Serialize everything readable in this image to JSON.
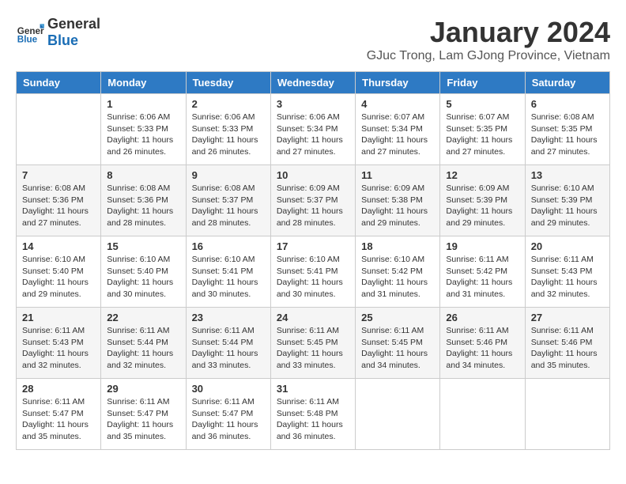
{
  "header": {
    "logo_general": "General",
    "logo_blue": "Blue",
    "month_title": "January 2024",
    "subtitle": "GJuc Trong, Lam GJong Province, Vietnam"
  },
  "columns": [
    "Sunday",
    "Monday",
    "Tuesday",
    "Wednesday",
    "Thursday",
    "Friday",
    "Saturday"
  ],
  "weeks": [
    [
      {
        "day": "",
        "info": ""
      },
      {
        "day": "1",
        "info": "Sunrise: 6:06 AM\nSunset: 5:33 PM\nDaylight: 11 hours\nand 26 minutes."
      },
      {
        "day": "2",
        "info": "Sunrise: 6:06 AM\nSunset: 5:33 PM\nDaylight: 11 hours\nand 26 minutes."
      },
      {
        "day": "3",
        "info": "Sunrise: 6:06 AM\nSunset: 5:34 PM\nDaylight: 11 hours\nand 27 minutes."
      },
      {
        "day": "4",
        "info": "Sunrise: 6:07 AM\nSunset: 5:34 PM\nDaylight: 11 hours\nand 27 minutes."
      },
      {
        "day": "5",
        "info": "Sunrise: 6:07 AM\nSunset: 5:35 PM\nDaylight: 11 hours\nand 27 minutes."
      },
      {
        "day": "6",
        "info": "Sunrise: 6:08 AM\nSunset: 5:35 PM\nDaylight: 11 hours\nand 27 minutes."
      }
    ],
    [
      {
        "day": "7",
        "info": "Sunrise: 6:08 AM\nSunset: 5:36 PM\nDaylight: 11 hours\nand 27 minutes."
      },
      {
        "day": "8",
        "info": "Sunrise: 6:08 AM\nSunset: 5:36 PM\nDaylight: 11 hours\nand 28 minutes."
      },
      {
        "day": "9",
        "info": "Sunrise: 6:08 AM\nSunset: 5:37 PM\nDaylight: 11 hours\nand 28 minutes."
      },
      {
        "day": "10",
        "info": "Sunrise: 6:09 AM\nSunset: 5:37 PM\nDaylight: 11 hours\nand 28 minutes."
      },
      {
        "day": "11",
        "info": "Sunrise: 6:09 AM\nSunset: 5:38 PM\nDaylight: 11 hours\nand 29 minutes."
      },
      {
        "day": "12",
        "info": "Sunrise: 6:09 AM\nSunset: 5:39 PM\nDaylight: 11 hours\nand 29 minutes."
      },
      {
        "day": "13",
        "info": "Sunrise: 6:10 AM\nSunset: 5:39 PM\nDaylight: 11 hours\nand 29 minutes."
      }
    ],
    [
      {
        "day": "14",
        "info": "Sunrise: 6:10 AM\nSunset: 5:40 PM\nDaylight: 11 hours\nand 29 minutes."
      },
      {
        "day": "15",
        "info": "Sunrise: 6:10 AM\nSunset: 5:40 PM\nDaylight: 11 hours\nand 30 minutes."
      },
      {
        "day": "16",
        "info": "Sunrise: 6:10 AM\nSunset: 5:41 PM\nDaylight: 11 hours\nand 30 minutes."
      },
      {
        "day": "17",
        "info": "Sunrise: 6:10 AM\nSunset: 5:41 PM\nDaylight: 11 hours\nand 30 minutes."
      },
      {
        "day": "18",
        "info": "Sunrise: 6:10 AM\nSunset: 5:42 PM\nDaylight: 11 hours\nand 31 minutes."
      },
      {
        "day": "19",
        "info": "Sunrise: 6:11 AM\nSunset: 5:42 PM\nDaylight: 11 hours\nand 31 minutes."
      },
      {
        "day": "20",
        "info": "Sunrise: 6:11 AM\nSunset: 5:43 PM\nDaylight: 11 hours\nand 32 minutes."
      }
    ],
    [
      {
        "day": "21",
        "info": "Sunrise: 6:11 AM\nSunset: 5:43 PM\nDaylight: 11 hours\nand 32 minutes."
      },
      {
        "day": "22",
        "info": "Sunrise: 6:11 AM\nSunset: 5:44 PM\nDaylight: 11 hours\nand 32 minutes."
      },
      {
        "day": "23",
        "info": "Sunrise: 6:11 AM\nSunset: 5:44 PM\nDaylight: 11 hours\nand 33 minutes."
      },
      {
        "day": "24",
        "info": "Sunrise: 6:11 AM\nSunset: 5:45 PM\nDaylight: 11 hours\nand 33 minutes."
      },
      {
        "day": "25",
        "info": "Sunrise: 6:11 AM\nSunset: 5:45 PM\nDaylight: 11 hours\nand 34 minutes."
      },
      {
        "day": "26",
        "info": "Sunrise: 6:11 AM\nSunset: 5:46 PM\nDaylight: 11 hours\nand 34 minutes."
      },
      {
        "day": "27",
        "info": "Sunrise: 6:11 AM\nSunset: 5:46 PM\nDaylight: 11 hours\nand 35 minutes."
      }
    ],
    [
      {
        "day": "28",
        "info": "Sunrise: 6:11 AM\nSunset: 5:47 PM\nDaylight: 11 hours\nand 35 minutes."
      },
      {
        "day": "29",
        "info": "Sunrise: 6:11 AM\nSunset: 5:47 PM\nDaylight: 11 hours\nand 35 minutes."
      },
      {
        "day": "30",
        "info": "Sunrise: 6:11 AM\nSunset: 5:47 PM\nDaylight: 11 hours\nand 36 minutes."
      },
      {
        "day": "31",
        "info": "Sunrise: 6:11 AM\nSunset: 5:48 PM\nDaylight: 11 hours\nand 36 minutes."
      },
      {
        "day": "",
        "info": ""
      },
      {
        "day": "",
        "info": ""
      },
      {
        "day": "",
        "info": ""
      }
    ]
  ]
}
